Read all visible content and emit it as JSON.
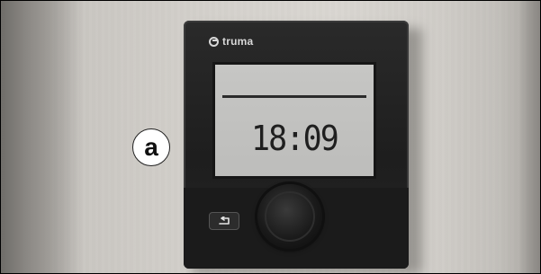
{
  "image": {
    "badge_label": "a",
    "device": {
      "brand_logo": "truma",
      "display": {
        "time": "18:09"
      },
      "controls": {
        "back_button_icon": "return-arrow-icon",
        "rotary_knob_icon": "rotary-knob-icon"
      }
    }
  }
}
